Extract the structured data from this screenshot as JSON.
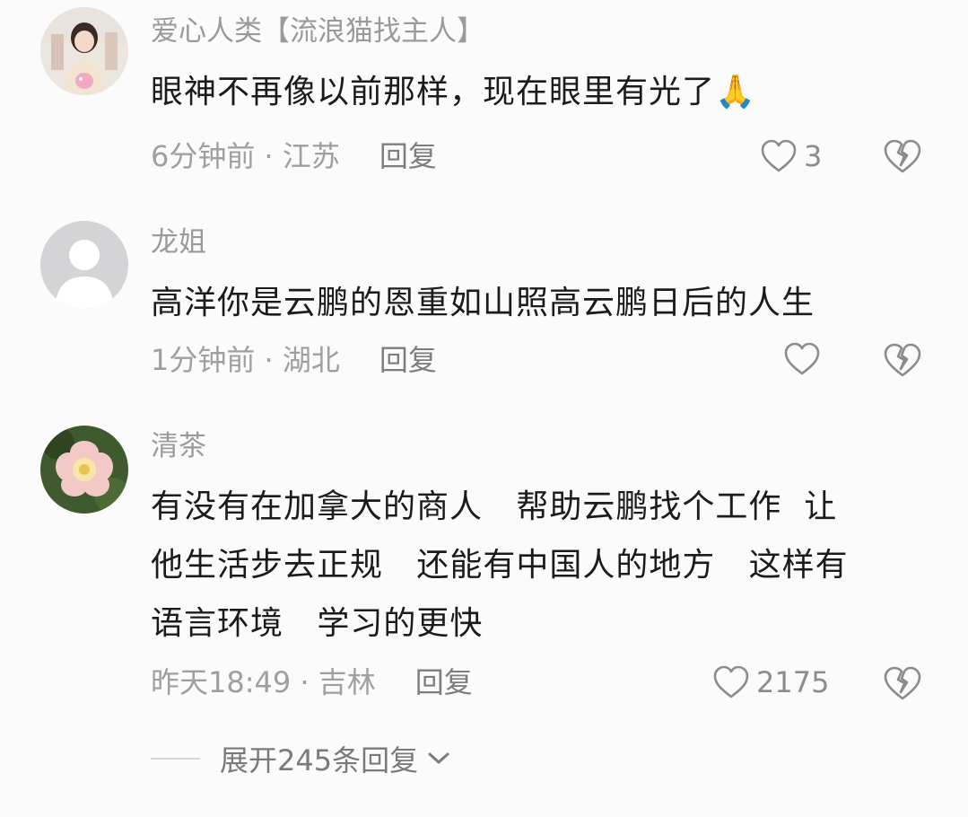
{
  "comments": [
    {
      "username": "爱心人类【流浪猫找主人】",
      "avatar_icon": "girl-photo-avatar",
      "lines": [
        "眼神不再像以前那样，现在眼里有光了🙏"
      ],
      "time": "6分钟前",
      "location": "江苏",
      "reply_label": "回复",
      "like_count": "3"
    },
    {
      "username": "龙姐",
      "avatar_icon": "default-person-avatar",
      "lines": [
        "高洋你是云鹏的恩重如山照高云鹏日后的人生"
      ],
      "time": "1分钟前",
      "location": "湖北",
      "reply_label": "回复",
      "like_count": ""
    },
    {
      "username": "清茶",
      "avatar_icon": "flower-photo-avatar",
      "lines": [
        "有没有在加拿大的商人   帮助云鹏找个工作  让",
        "他生活步去正规   还能有中国人的地方   这样有",
        "语言环境   学习的更快"
      ],
      "time": "昨天18:49",
      "location": "吉林",
      "reply_label": "回复",
      "like_count": "2175"
    }
  ],
  "meta_separator": " · ",
  "expand_label": "展开245条回复",
  "colors": {
    "background": "#fbfbfb",
    "text_primary": "#1b1b1b",
    "text_secondary": "#9f9f9f",
    "icon": "#8c8c8c"
  }
}
